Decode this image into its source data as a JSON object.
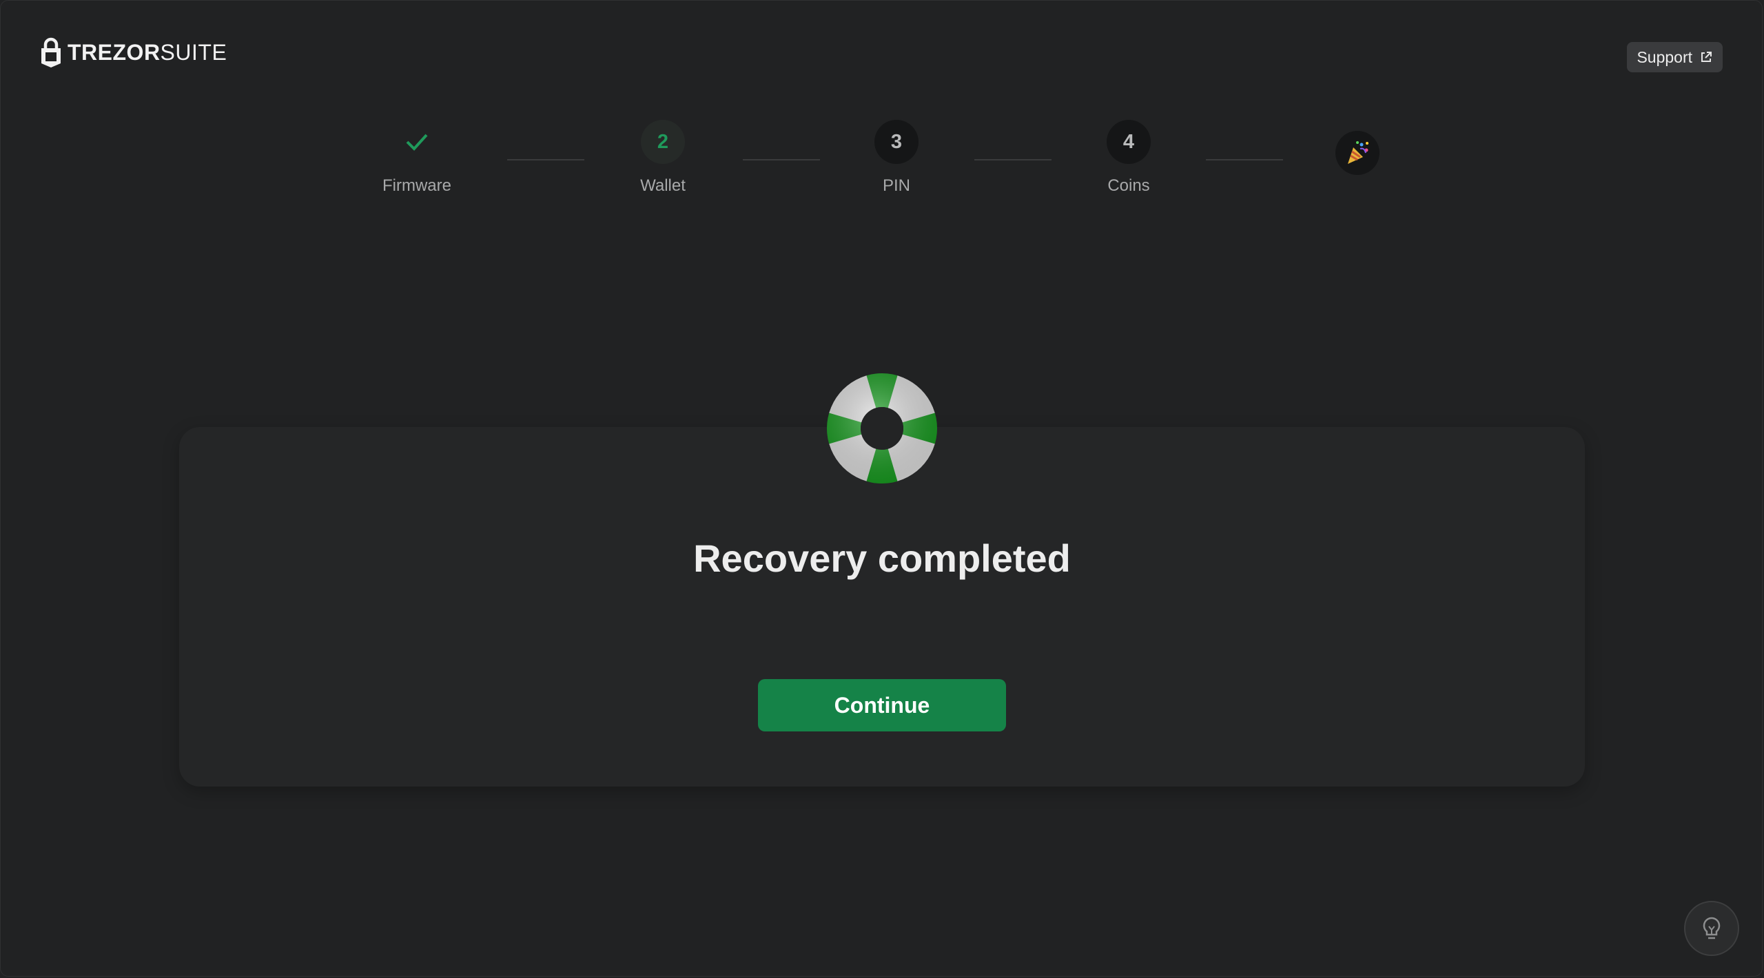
{
  "header": {
    "logo_bold": "TREZOR",
    "logo_light": "SUITE",
    "support_label": "Support",
    "support_icon": "external-link-icon"
  },
  "stepper": {
    "steps": [
      {
        "label": "Firmware",
        "state": "done",
        "icon": "check-icon"
      },
      {
        "label": "Wallet",
        "number": "2",
        "state": "active"
      },
      {
        "label": "PIN",
        "number": "3",
        "state": "pending"
      },
      {
        "label": "Coins",
        "number": "4",
        "state": "pending"
      }
    ],
    "final_icon": "party-popper-icon"
  },
  "main": {
    "illustration": "lifebuoy-icon",
    "title": "Recovery completed",
    "continue_label": "Continue"
  },
  "footer": {
    "tip_icon": "lightbulb-icon"
  },
  "colors": {
    "background": "#212223",
    "card": "#252627",
    "accent": "#158348",
    "accent_text": "#1f9a5b"
  }
}
